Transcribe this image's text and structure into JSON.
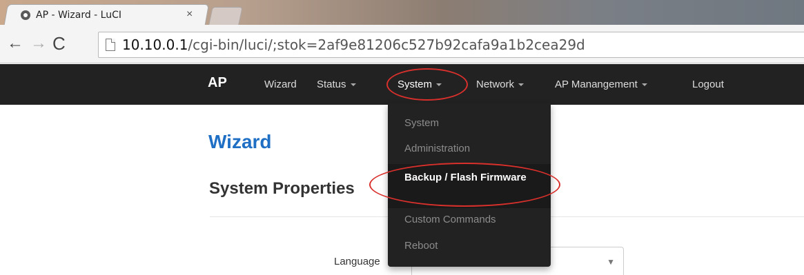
{
  "browser": {
    "tab_title": "AP - Wizard - LuCI",
    "tab_close": "×",
    "url_host": "10.10.0.1",
    "url_path": "/cgi-bin/luci/;stok=2af9e81206c527b92cafa9a1b2cea29d",
    "back": "←",
    "forward": "→",
    "reload": "C"
  },
  "navbar": {
    "brand": "AP",
    "items": [
      {
        "label": "Wizard"
      },
      {
        "label": "Status"
      },
      {
        "label": "System"
      },
      {
        "label": "Network"
      },
      {
        "label": "AP Manangement"
      },
      {
        "label": "Logout"
      }
    ]
  },
  "dropdown": {
    "items": [
      {
        "label": "System"
      },
      {
        "label": "Administration"
      },
      {
        "label": "Backup / Flash Firmware"
      },
      {
        "label": "Custom Commands"
      },
      {
        "label": "Reboot"
      }
    ]
  },
  "page": {
    "title": "Wizard",
    "section_title": "System Properties",
    "language_label": "Language",
    "select_arrow": "▼"
  },
  "colors": {
    "navbar_bg": "#222222",
    "title_blue": "#1f6fc5",
    "highlight_red": "#d9302c"
  }
}
